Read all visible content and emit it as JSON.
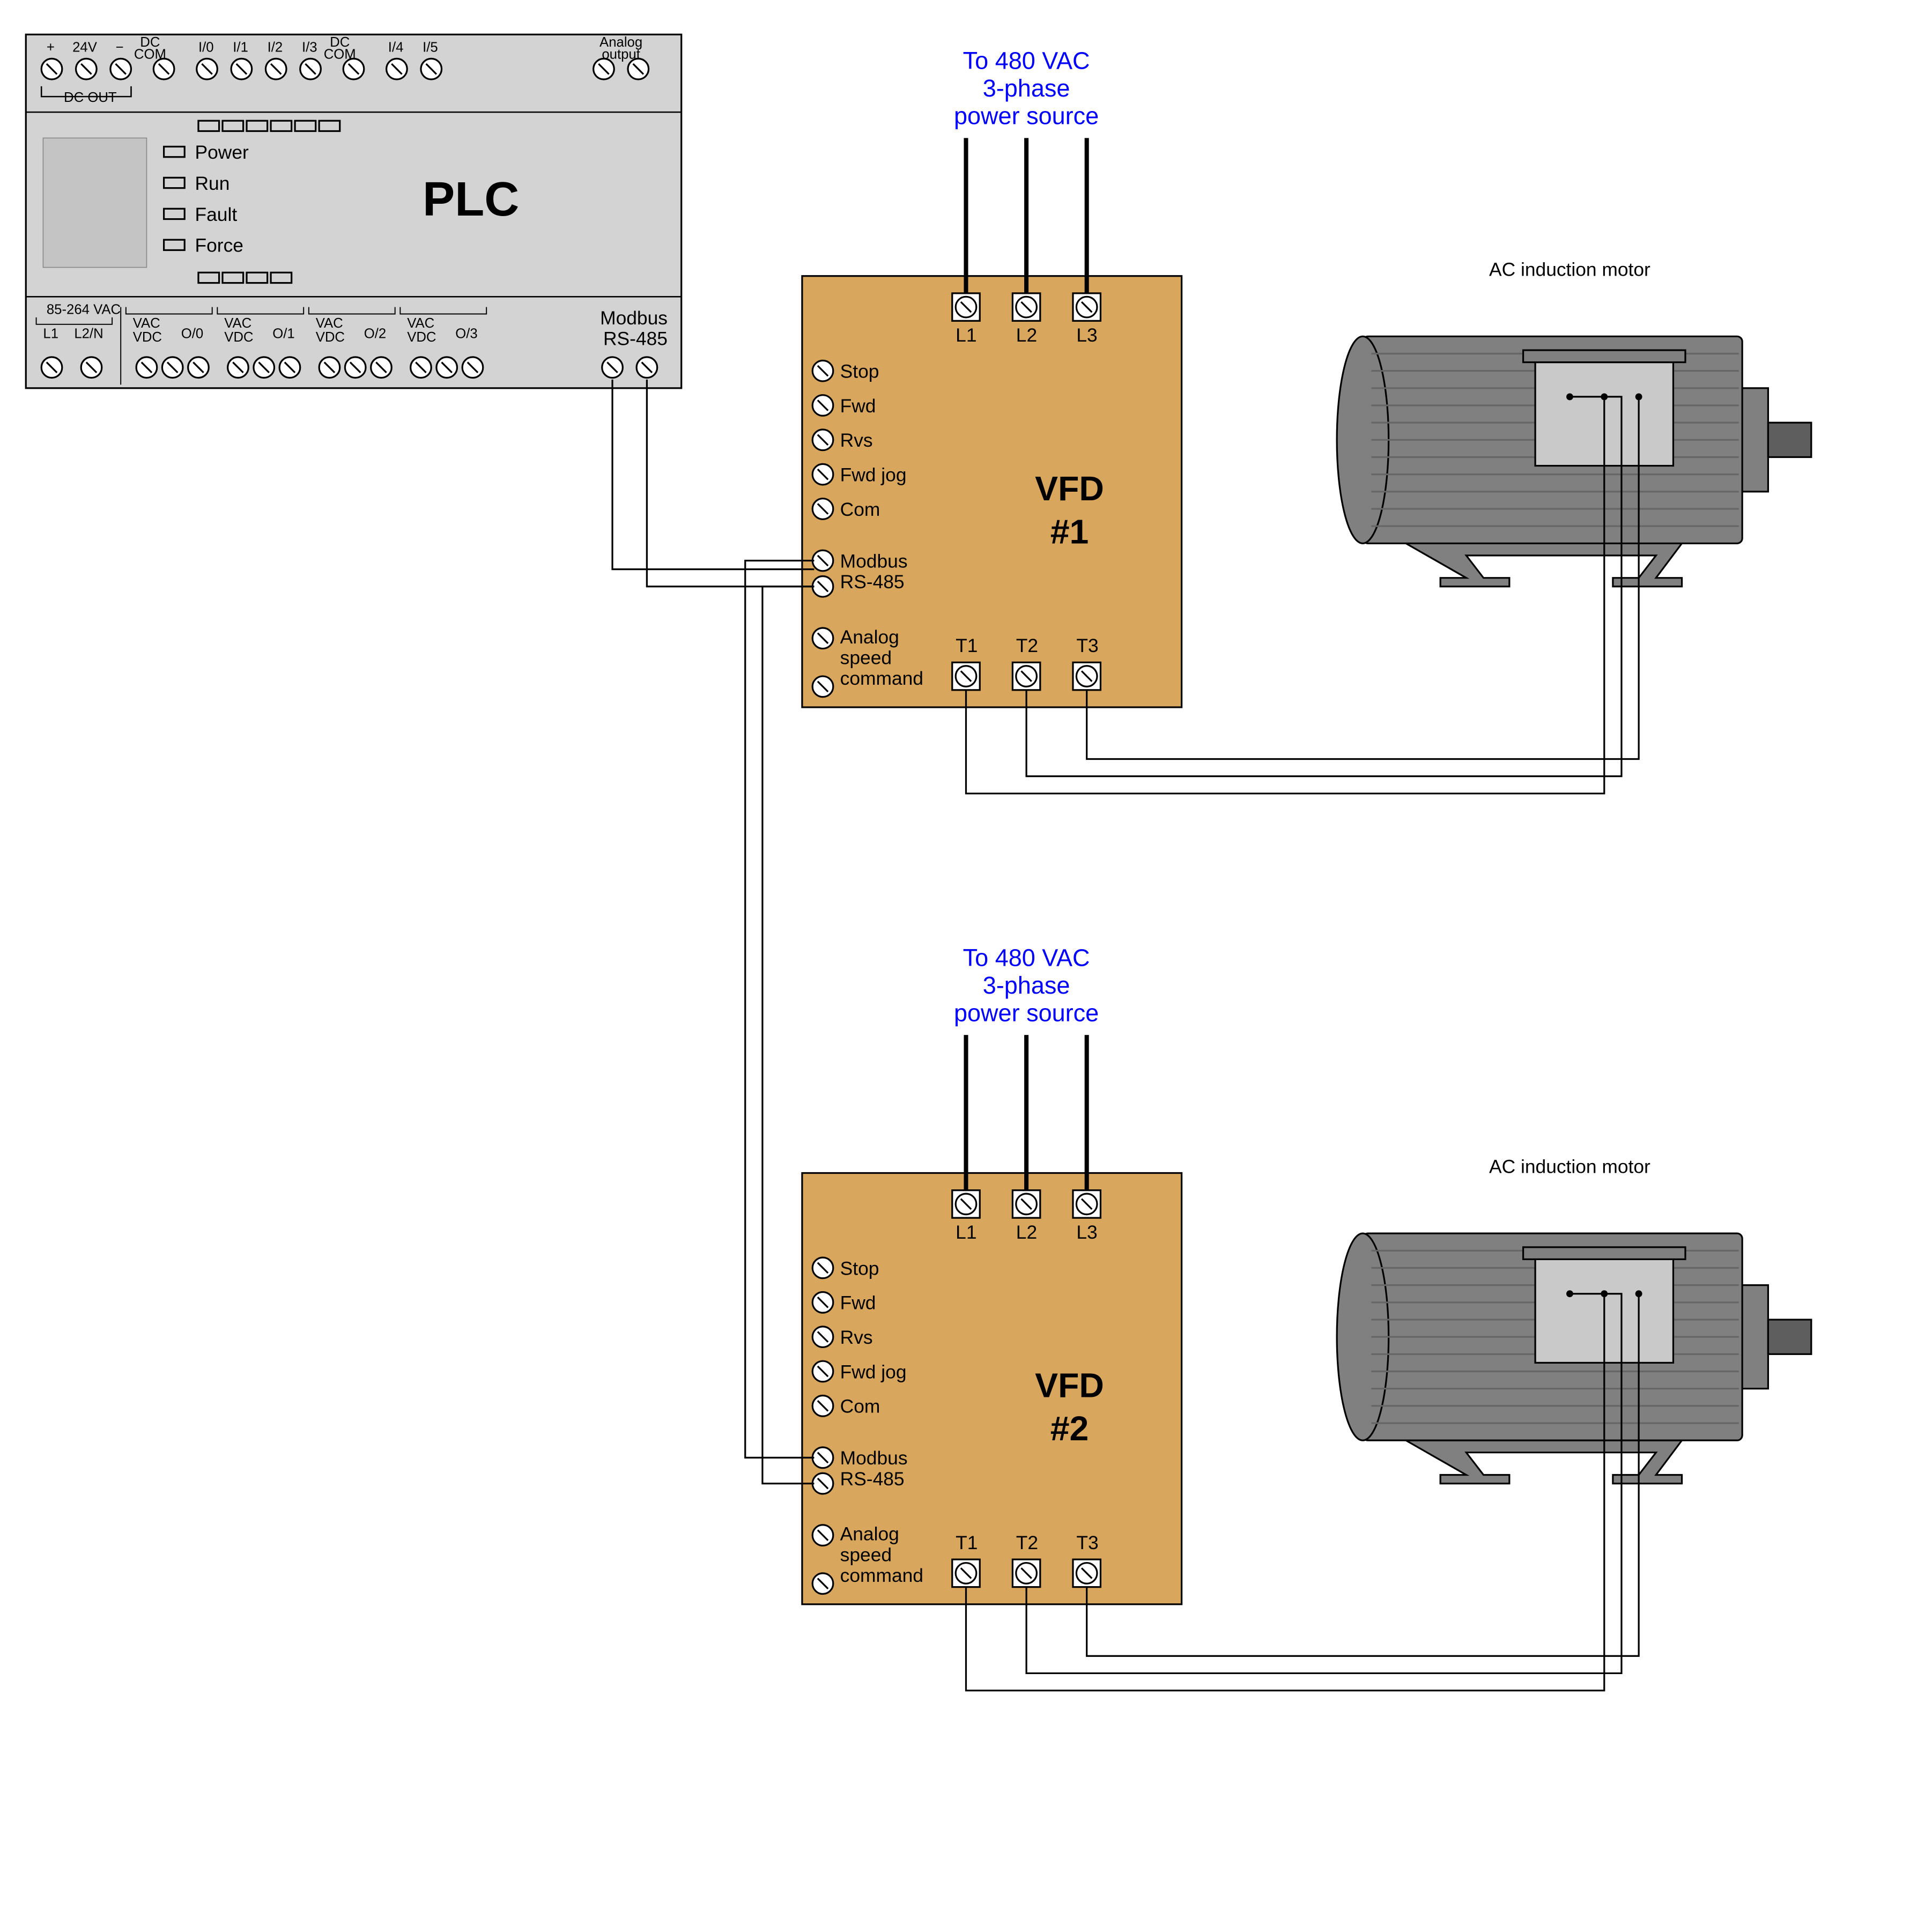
{
  "plc": {
    "title": "PLC",
    "status": [
      "Power",
      "Run",
      "Fault",
      "Force"
    ],
    "top_terms": [
      "+",
      "24V",
      "−",
      "DC COM",
      "I/0",
      "I/1",
      "I/2",
      "I/3",
      "DC COM",
      "I/4",
      "I/5",
      "Analog output"
    ],
    "dc_out": "DC OUT",
    "modbus": "Modbus RS-485",
    "bottom_labels": [
      "85-264 VAC",
      "L1",
      "L2/N",
      "VAC VDC",
      "O/0",
      "VAC VDC",
      "O/1",
      "VAC VDC",
      "O/2",
      "VAC VDC",
      "O/3"
    ]
  },
  "power_source": {
    "line1": "To 480 VAC",
    "line2": "3-phase",
    "line3": "power source"
  },
  "vfd": {
    "name1": "VFD",
    "sub1": "#1",
    "name2": "VFD",
    "sub2": "#2",
    "inputs": [
      "Stop",
      "Fwd",
      "Rvs",
      "Fwd jog",
      "Com"
    ],
    "modbus1": "Modbus",
    "modbus2": "RS-485",
    "analog1": "Analog",
    "analog2": "speed",
    "analog3": "command",
    "L": [
      "L1",
      "L2",
      "L3"
    ],
    "T": [
      "T1",
      "T2",
      "T3"
    ]
  },
  "motor": {
    "label": "AC induction motor"
  }
}
